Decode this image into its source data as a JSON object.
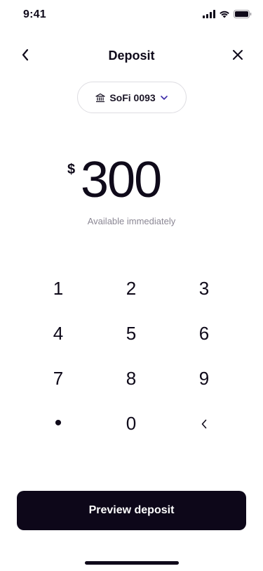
{
  "status_bar": {
    "time": "9:41"
  },
  "header": {
    "title": "Deposit"
  },
  "account": {
    "label": "SoFi 0093"
  },
  "amount": {
    "currency": "$",
    "value": "300",
    "subtext": "Available immediately"
  },
  "keypad": {
    "keys": [
      "1",
      "2",
      "3",
      "4",
      "5",
      "6",
      "7",
      "8",
      "9",
      "•",
      "0"
    ]
  },
  "cta": {
    "label": "Preview deposit"
  },
  "colors": {
    "primary": "#0d0719",
    "muted": "#8b8794",
    "accent_chevron": "#3b2aa8"
  }
}
